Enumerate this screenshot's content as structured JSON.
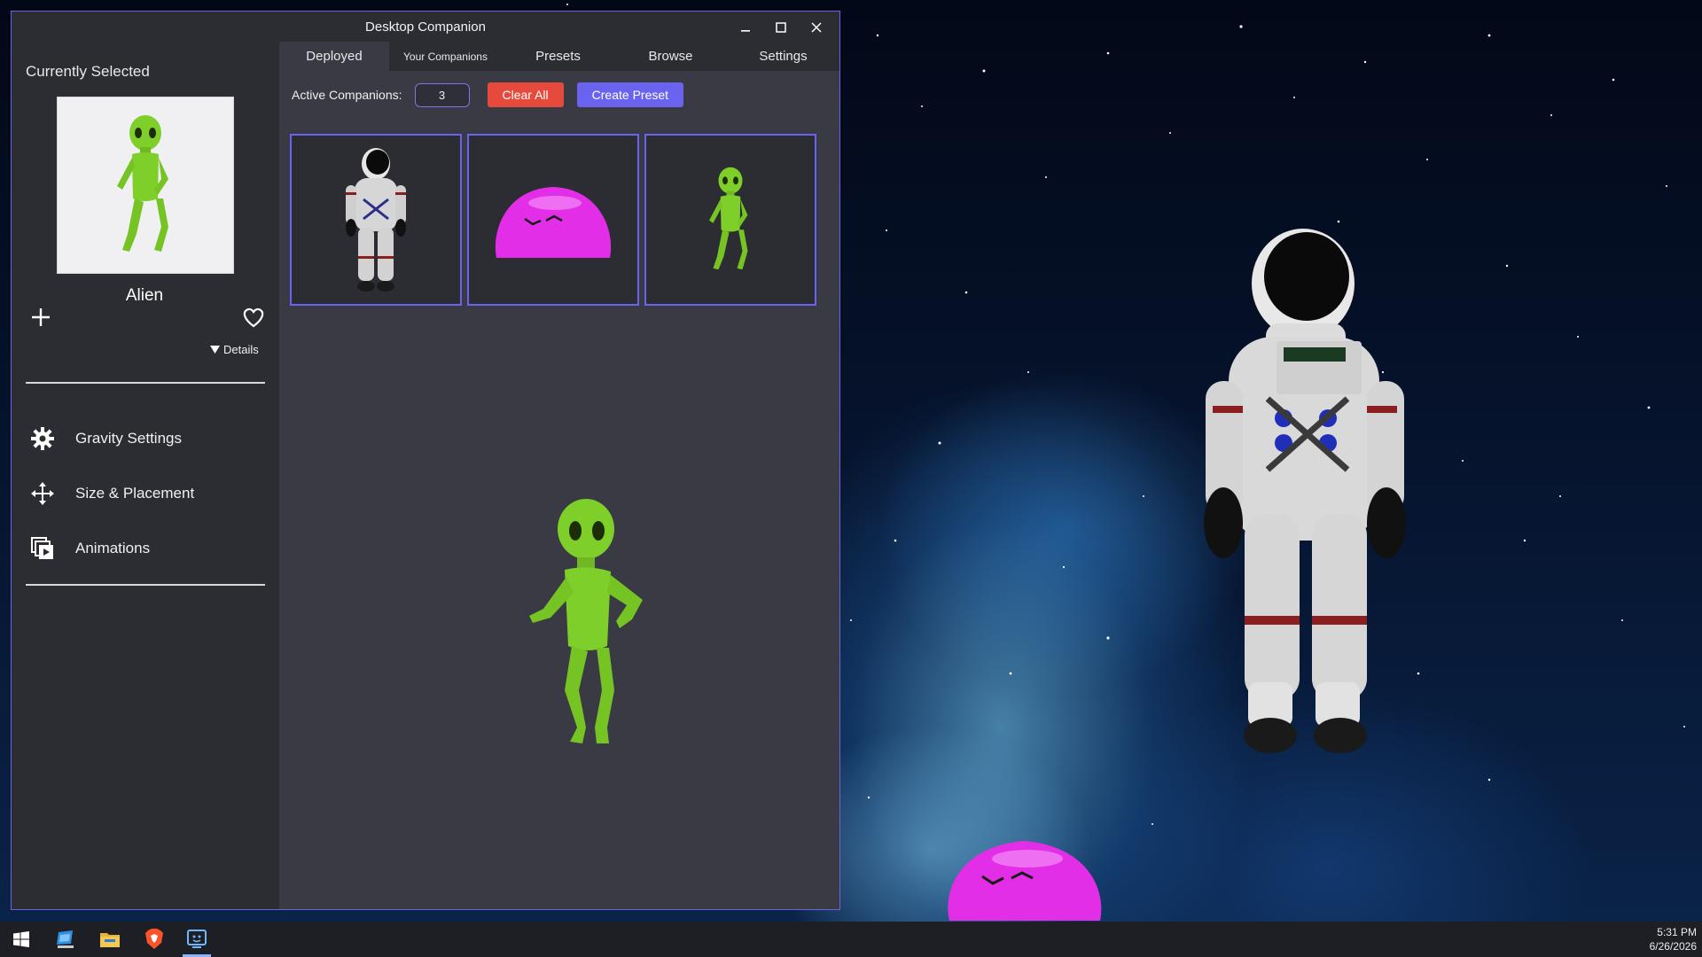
{
  "window": {
    "title": "Desktop Companion"
  },
  "sidebar": {
    "currently_selected_label": "Currently Selected",
    "selected_name": "Alien",
    "details_label": "Details",
    "menu": [
      {
        "label": "Gravity Settings",
        "icon": "gear-icon"
      },
      {
        "label": "Size & Placement",
        "icon": "move-arrows-icon"
      },
      {
        "label": "Animations",
        "icon": "animations-icon"
      }
    ]
  },
  "tabs": [
    {
      "label": "Deployed",
      "active": true
    },
    {
      "label": "Your Companions",
      "active": false
    },
    {
      "label": "Presets",
      "active": false
    },
    {
      "label": "Browse",
      "active": false
    },
    {
      "label": "Settings",
      "active": false
    }
  ],
  "toolbar": {
    "active_companions_label": "Active Companions:",
    "active_companions_value": "3",
    "clear_all_label": "Clear All",
    "create_preset_label": "Create Preset"
  },
  "deployed": [
    {
      "name": "Astronaut",
      "icon": "astronaut-icon"
    },
    {
      "name": "Slime",
      "icon": "slime-icon"
    },
    {
      "name": "Alien",
      "icon": "alien-icon"
    }
  ],
  "taskbar": {
    "items": [
      "windows-start-icon",
      "desktop-app-icon",
      "file-explorer-icon",
      "brave-browser-icon",
      "desktop-companion-icon"
    ],
    "time": "5:31 PM",
    "date": "6/26/2026"
  },
  "colors": {
    "accent": "#6a63f0",
    "danger": "#e64a3c",
    "window_bg": "#2c2c33",
    "panel_bg": "#393a44",
    "alien_green": "#7fcf2a",
    "slime_magenta": "#e22ee6"
  }
}
